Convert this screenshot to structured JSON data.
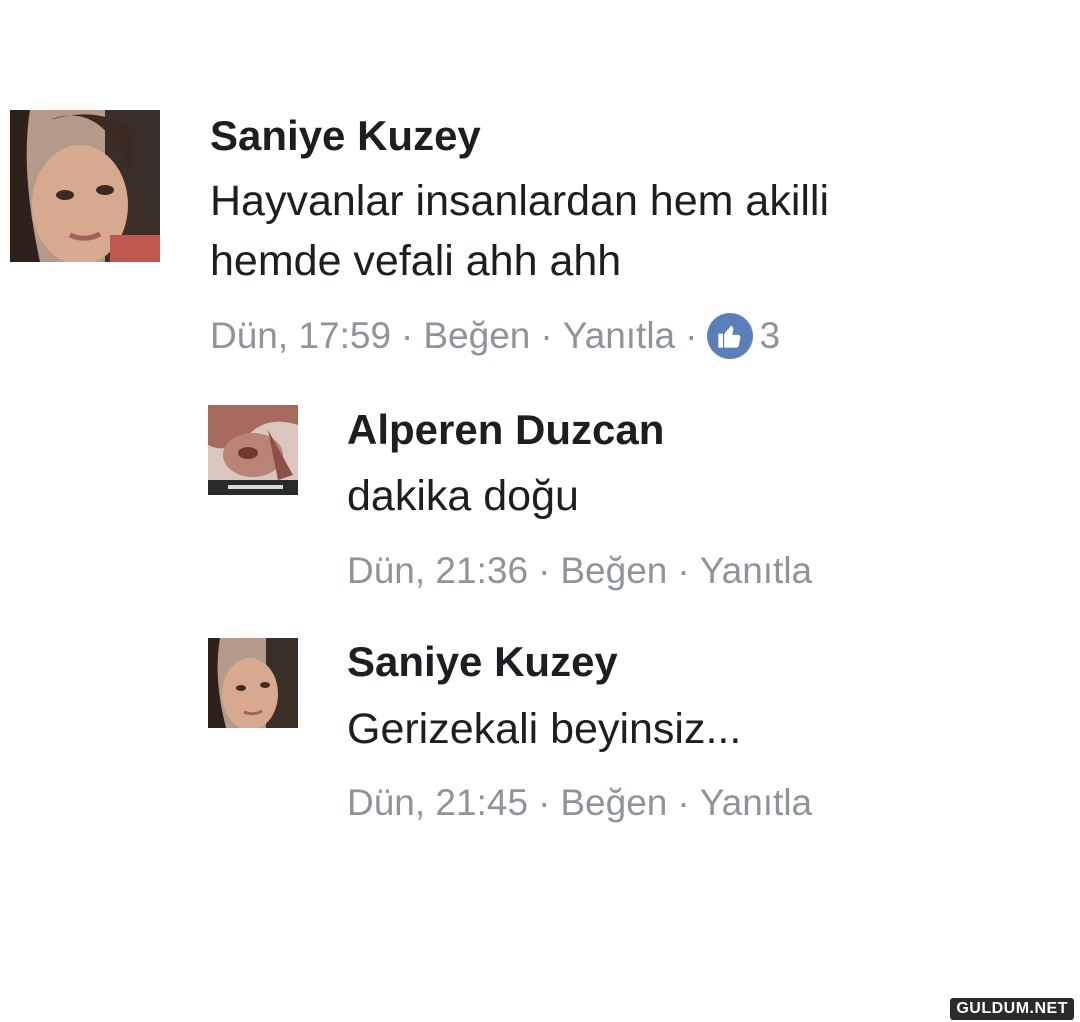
{
  "comments": [
    {
      "author": "Saniye Kuzey",
      "text_lines": [
        "Hayvanlar insanlardan hem akilli",
        "hemde vefali ahh ahh"
      ],
      "time": "Dün, 17:59",
      "like_label": "Beğen",
      "reply_label": "Yanıtla",
      "reaction_count": "3",
      "separator": "·"
    },
    {
      "author": "Alperen Duzcan",
      "text_lines": [
        "dakika doğu"
      ],
      "time": "Dün, 21:36",
      "like_label": "Beğen",
      "reply_label": "Yanıtla",
      "separator": "·"
    },
    {
      "author": "Saniye Kuzey",
      "text_lines": [
        "Gerizekali beyinsiz..."
      ],
      "time": "Dün, 21:45",
      "like_label": "Beğen",
      "reply_label": "Yanıtla",
      "separator": "·"
    }
  ],
  "icons": {
    "reaction": "thumbs-up-icon"
  },
  "colors": {
    "reaction_badge": "#5b80b9",
    "meta_text": "#8f949b",
    "author_text": "#1c1e21"
  },
  "watermark": "GULDUM.NET"
}
